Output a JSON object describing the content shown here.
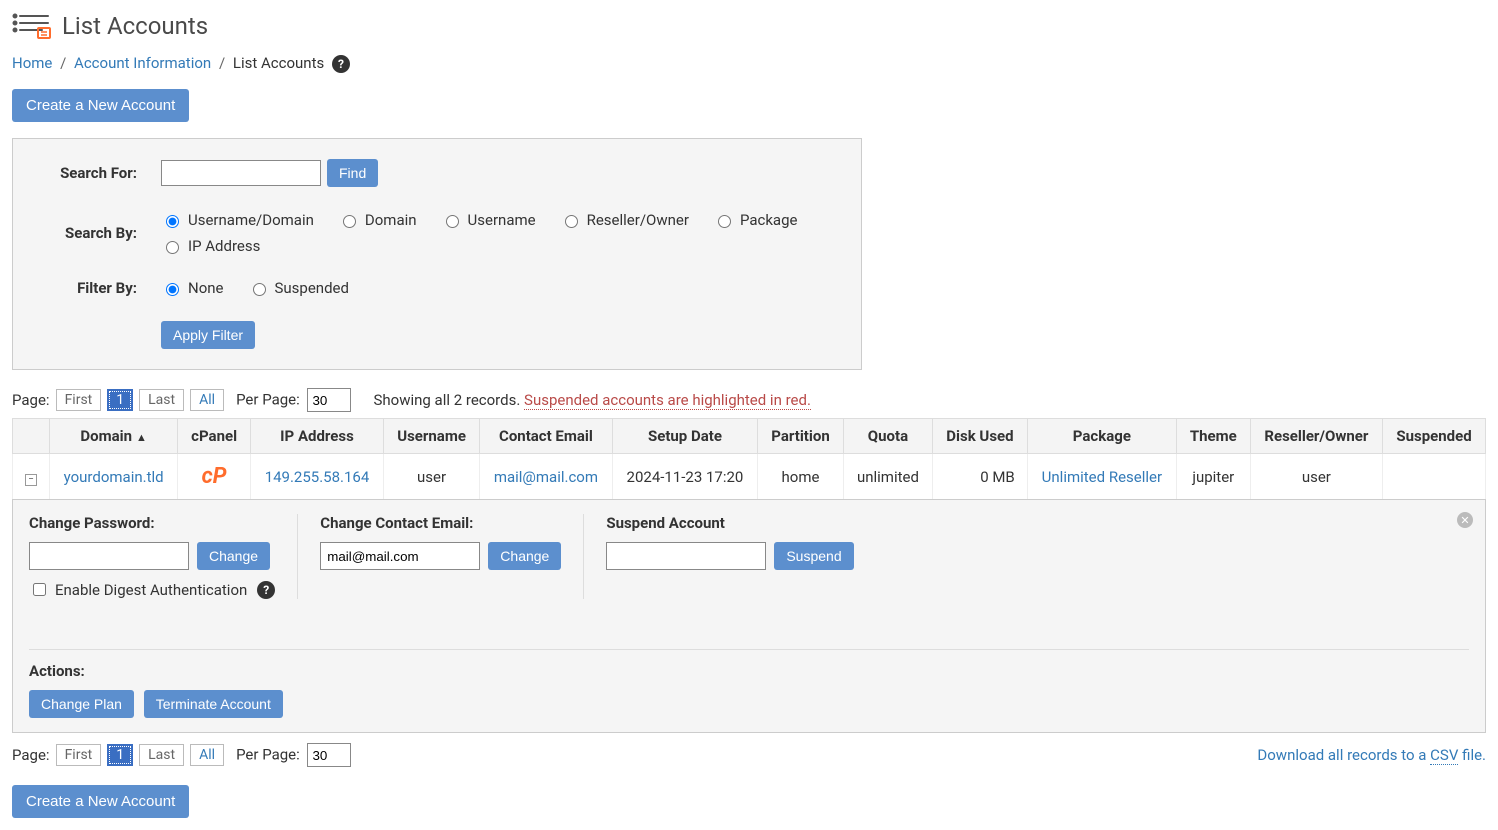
{
  "header": {
    "title": "List Accounts"
  },
  "breadcrumb": {
    "home": "Home",
    "accountInfo": "Account Information",
    "current": "List Accounts"
  },
  "buttons": {
    "createAccount": "Create a New Account",
    "find": "Find",
    "applyFilter": "Apply Filter",
    "change": "Change",
    "suspend": "Suspend",
    "changePlan": "Change Plan",
    "terminate": "Terminate Account"
  },
  "filter": {
    "searchForLabel": "Search For:",
    "searchByLabel": "Search By:",
    "filterByLabel": "Filter By:",
    "searchBy": {
      "usernameDomain": "Username/Domain",
      "domain": "Domain",
      "username": "Username",
      "resellerOwner": "Reseller/Owner",
      "package": "Package",
      "ipAddress": "IP Address"
    },
    "filterBy": {
      "none": "None",
      "suspended": "Suspended"
    }
  },
  "pager": {
    "pageLabel": "Page:",
    "first": "First",
    "current": "1",
    "last": "Last",
    "all": "All",
    "perPageLabel": "Per Page:",
    "perPageValue": "30",
    "showing": "Showing all 2 records.",
    "suspendedNote": "Suspended accounts are highlighted in red."
  },
  "columns": {
    "domain": "Domain",
    "cpanel": "cPanel",
    "ip": "IP Address",
    "username": "Username",
    "email": "Contact Email",
    "setup": "Setup Date",
    "partition": "Partition",
    "quota": "Quota",
    "disk": "Disk Used",
    "package": "Package",
    "theme": "Theme",
    "owner": "Reseller/Owner",
    "suspended": "Suspended"
  },
  "row": {
    "domain": "yourdomain.tld",
    "ip": "149.255.58.164",
    "username": "user",
    "email": "mail@mail.com",
    "setup": "2024-11-23 17:20",
    "partition": "home",
    "quota": "unlimited",
    "disk": "0 MB",
    "package": "Unlimited Reseller",
    "theme": "jupiter",
    "owner": "user",
    "suspended": ""
  },
  "expand": {
    "changePassword": "Change Password:",
    "enableDigest": "Enable Digest Authentication",
    "changeEmail": "Change Contact Email:",
    "emailValue": "mail@mail.com",
    "suspendAccount": "Suspend Account",
    "actions": "Actions:"
  },
  "download": {
    "prefix": "Download all records to a ",
    "csv": "CSV",
    "suffix": " file."
  }
}
